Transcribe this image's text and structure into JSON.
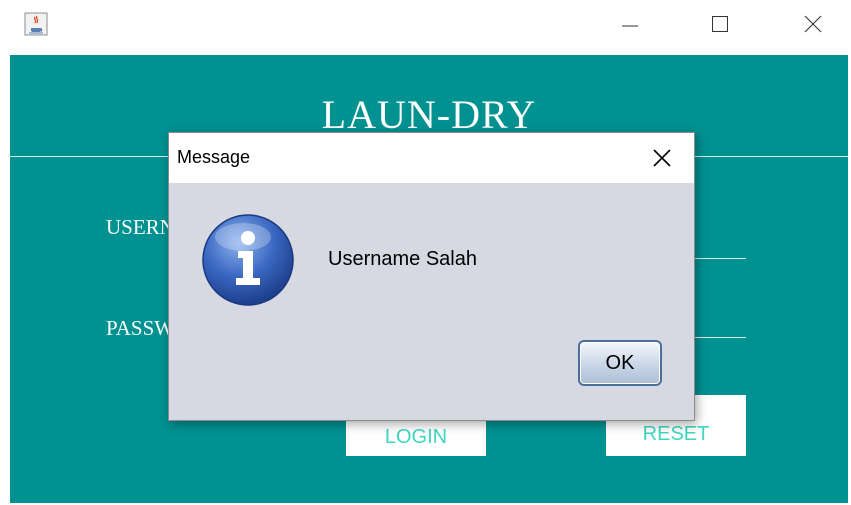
{
  "window": {
    "icon": "java-cup-icon",
    "controls": {
      "minimize": "minimize-icon",
      "maximize": "maximize-icon",
      "close": "close-icon"
    }
  },
  "app": {
    "title": "LAUN-DRY",
    "username_label": "USERNAME",
    "password_label": "PASSWORD",
    "login_label": "LOGIN",
    "reset_label": "RESET",
    "background_color": "#009191",
    "button_text_color": "#3fd6bf"
  },
  "dialog": {
    "title": "Message",
    "message": "Username Salah",
    "ok_label": "OK",
    "icon": "info-icon",
    "background_color": "#d6d9e1"
  }
}
